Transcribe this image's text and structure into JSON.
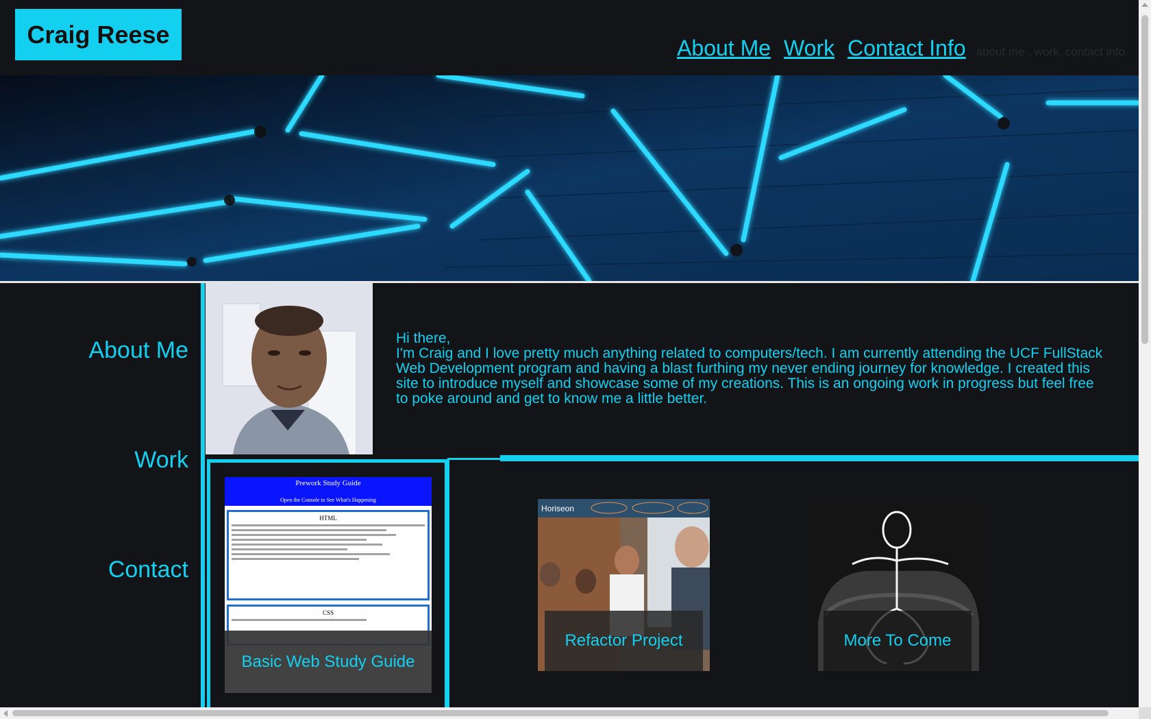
{
  "header": {
    "logo": "Craig Reese",
    "nav": [
      "About Me",
      "Work",
      "Contact Info"
    ],
    "nav_hint": "about me , work, contact info"
  },
  "sidebar": {
    "items": [
      "About Me",
      "Work",
      "Contact"
    ]
  },
  "about": {
    "greeting": "Hi there,",
    "body": "I'm Craig and I love pretty much anything related to computers/tech. I am currently attending the UCF FullStack Web Development program and having a blast furthing my never ending journey for knowledge. I created this site to introduce myself and showcase some of my creations. This is an ongoing work in progress but feel free to poke around and get to know me a little better."
  },
  "work": {
    "cards": [
      {
        "label": "Basic Web Study Guide",
        "preview_title": "Prework Study Guide",
        "preview_subtitle": "Open the Console to See What's Happening",
        "preview_section1": "HTML",
        "preview_section2": "CSS"
      },
      {
        "label": "Refactor Project",
        "preview_brand": "Horiseon"
      },
      {
        "label": "More To Come"
      }
    ]
  },
  "colors": {
    "accent": "#14d0f0",
    "background": "#131417"
  }
}
